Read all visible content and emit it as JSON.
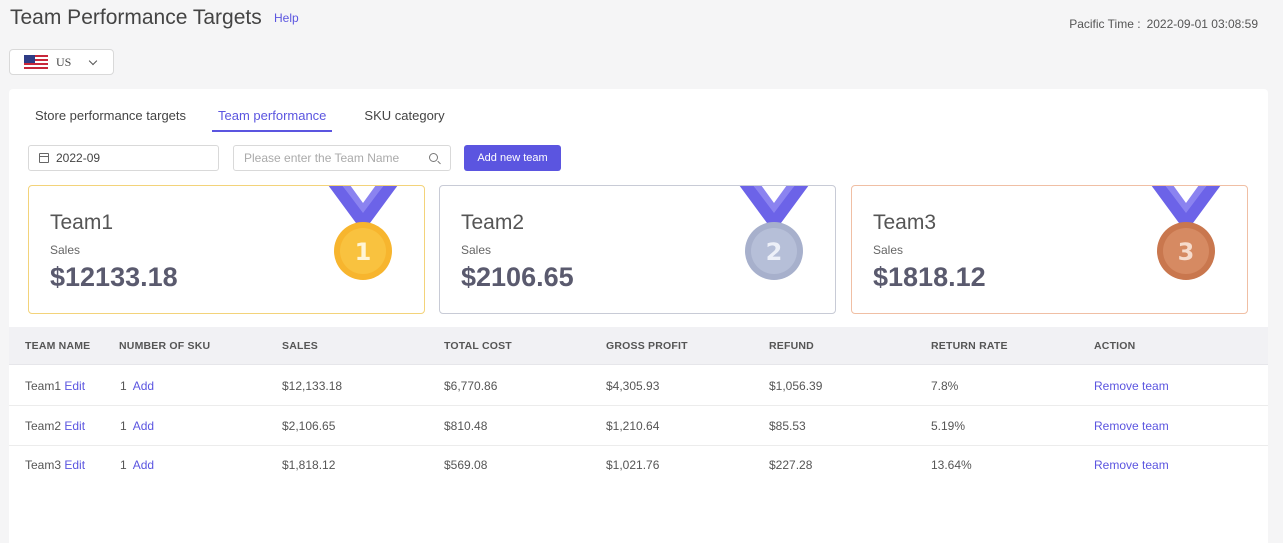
{
  "header": {
    "title": "Team Performance Targets",
    "help": "Help",
    "time_label": "Pacific Time :",
    "time_value": "2022-09-01 03:08:59"
  },
  "country": {
    "value": "US",
    "flag_icon": "us-flag-icon"
  },
  "tabs": [
    {
      "label": "Store performance targets",
      "active": false
    },
    {
      "label": "Team performance",
      "active": true
    },
    {
      "label": "SKU category",
      "active": false
    }
  ],
  "filters": {
    "month": "2022-09",
    "search_placeholder": "Please enter the Team Name",
    "add_button": "Add new team"
  },
  "ranking": [
    {
      "name": "Team1",
      "label": "Sales",
      "value": "$12133.18",
      "rank": "1",
      "color": "#f5a623"
    },
    {
      "name": "Team2",
      "label": "Sales",
      "value": "$2106.65",
      "rank": "2",
      "color": "#9ba6c8"
    },
    {
      "name": "Team3",
      "label": "Sales",
      "value": "$1818.12",
      "rank": "3",
      "color": "#c9774e"
    }
  ],
  "table": {
    "columns": [
      "TEAM NAME",
      "NUMBER OF SKU",
      "SALES",
      "TOTAL COST",
      "GROSS PROFIT",
      "REFUND",
      "RETURN RATE",
      "ACTION"
    ],
    "rows": [
      {
        "team": "Team1",
        "edit": "Edit",
        "sku": "1",
        "add": "Add",
        "sales": "$12,133.18",
        "cost": "$6,770.86",
        "profit": "$4,305.93",
        "refund": "$1,056.39",
        "rate": "7.8%",
        "action": "Remove team"
      },
      {
        "team": "Team2",
        "edit": "Edit",
        "sku": "1",
        "add": "Add",
        "sales": "$2,106.65",
        "cost": "$810.48",
        "profit": "$1,210.64",
        "refund": "$85.53",
        "rate": "5.19%",
        "action": "Remove team"
      },
      {
        "team": "Team3",
        "edit": "Edit",
        "sku": "1",
        "add": "Add",
        "sales": "$1,818.12",
        "cost": "$569.08",
        "profit": "$1,021.76",
        "refund": "$227.28",
        "rate": "13.64%",
        "action": "Remove team"
      }
    ]
  },
  "colors": {
    "accent": "#5b55e0",
    "gold": "#f5a623",
    "silver": "#9ba6c8",
    "bronze": "#c9774e"
  }
}
